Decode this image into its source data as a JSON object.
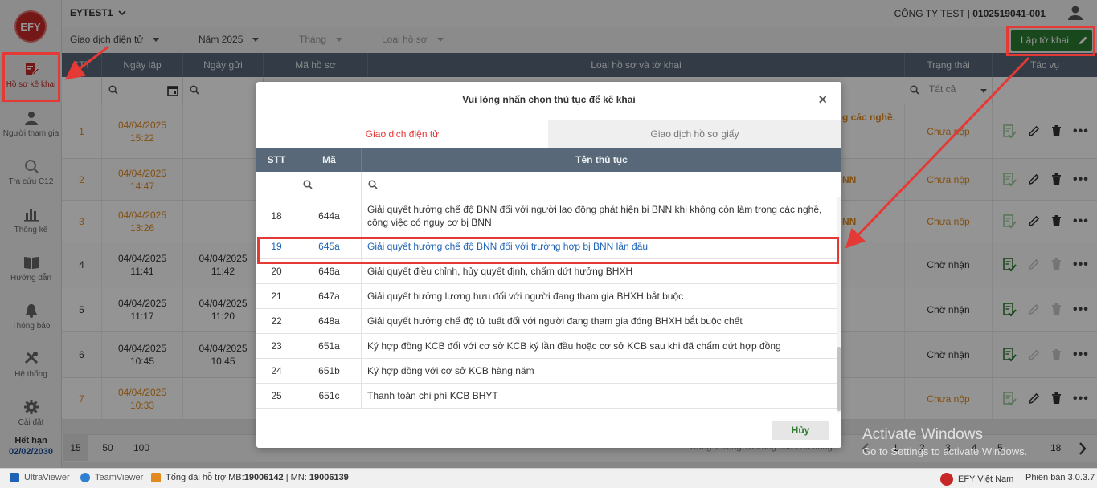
{
  "sidebar": {
    "logo": "EFY",
    "items": [
      {
        "label": "Hồ sơ kê khai",
        "icon": "document-edit-icon"
      },
      {
        "label": "Người tham gia",
        "icon": "person-icon"
      },
      {
        "label": "Tra cứu C12",
        "icon": "search-icon"
      },
      {
        "label": "Thống kê",
        "icon": "bar-chart-icon"
      },
      {
        "label": "Hướng dẫn",
        "icon": "book-icon"
      },
      {
        "label": "Thông báo",
        "icon": "bell-icon"
      },
      {
        "label": "Hệ thống",
        "icon": "tools-icon"
      },
      {
        "label": "Cài đặt",
        "icon": "gear-icon"
      }
    ],
    "expiry_label": "Hết hạn",
    "expiry_date": "02/02/2030"
  },
  "topbar": {
    "company_select": "EYTEST1",
    "company_name": "CÔNG TY TEST | ",
    "company_code": "0102519041-001"
  },
  "filters": {
    "type": "Giao dịch điện tử",
    "year": "Năm 2025",
    "month": "Tháng",
    "record_type": "Loại hồ sơ",
    "create_button": "Lập tờ khai"
  },
  "main_table": {
    "headers": {
      "stt": "STT",
      "created": "Ngày lập",
      "sent": "Ngày gửi",
      "code": "Mã hồ sơ",
      "type": "Loại hồ sơ và tờ khai",
      "status": "Trạng thái",
      "actions": "Tác vụ"
    },
    "status_filter": "Tất cả",
    "rows": [
      {
        "stt": "1",
        "created_date": "04/04/2025",
        "created_time": "15:22",
        "sent_date": "",
        "sent_time": "",
        "type_stub": "g các nghề,",
        "status": "Chưa nộp"
      },
      {
        "stt": "2",
        "created_date": "04/04/2025",
        "created_time": "14:47",
        "sent_date": "",
        "sent_time": "",
        "type_stub": "NN",
        "status": "Chưa nộp"
      },
      {
        "stt": "3",
        "created_date": "04/04/2025",
        "created_time": "13:26",
        "sent_date": "",
        "sent_time": "",
        "type_stub": "NN",
        "status": "Chưa nộp"
      },
      {
        "stt": "4",
        "created_date": "04/04/2025",
        "created_time": "11:41",
        "sent_date": "04/04/2025",
        "sent_time": "11:42",
        "type_stub": "",
        "status": "Chờ nhận"
      },
      {
        "stt": "5",
        "created_date": "04/04/2025",
        "created_time": "11:17",
        "sent_date": "04/04/2025",
        "sent_time": "11:20",
        "type_stub": "",
        "status": "Chờ nhận"
      },
      {
        "stt": "6",
        "created_date": "04/04/2025",
        "created_time": "10:45",
        "sent_date": "04/04/2025",
        "sent_time": "10:45",
        "type_stub": "",
        "status": "Chờ nhận"
      },
      {
        "stt": "7",
        "created_date": "04/04/2025",
        "created_time": "10:33",
        "sent_date": "",
        "sent_time": "",
        "type_stub": "",
        "status": "Chưa nộp"
      }
    ]
  },
  "pagination": {
    "page_sizes": [
      "15",
      "50",
      "100"
    ],
    "info": "Trang 1 trong 18 trang của 259 dòng",
    "pages": [
      "1",
      "2",
      "3",
      "4",
      "5",
      "18"
    ]
  },
  "modal": {
    "title": "Vui lòng nhấn chọn thủ tục để kê khai",
    "close": "×",
    "tab_electronic": "Giao dịch điện tử",
    "tab_paper": "Giao dịch hồ sơ giấy",
    "headers": {
      "stt": "STT",
      "code": "Mã",
      "name": "Tên thủ tục"
    },
    "rows": [
      {
        "stt": "18",
        "code": "644a",
        "name": "Giải quyết hưởng chế độ BNN đối với người lao động phát hiện bị BNN khi không còn làm trong các nghề, công việc có nguy cơ bị BNN"
      },
      {
        "stt": "19",
        "code": "645a",
        "name": "Giải quyết hưởng chế độ BNN đối với trường hợp bị BNN lần đầu"
      },
      {
        "stt": "20",
        "code": "646a",
        "name": "Giải quyết điều chỉnh, hủy quyết định, chấm dứt hưởng BHXH"
      },
      {
        "stt": "21",
        "code": "647a",
        "name": "Giải quyết hưởng lương hưu đối với người đang tham gia BHXH bắt buộc"
      },
      {
        "stt": "22",
        "code": "648a",
        "name": "Giải quyết hưởng chế độ tử tuất đối với người đang tham gia đóng BHXH bắt buộc chết"
      },
      {
        "stt": "23",
        "code": "651a",
        "name": "Ký hợp đồng KCB đối với cơ sở KCB ký lần đầu hoặc cơ sở KCB sau khi đã chấm dứt hợp đồng"
      },
      {
        "stt": "24",
        "code": "651b",
        "name": "Ký hợp đồng với cơ sở KCB hàng năm"
      },
      {
        "stt": "25",
        "code": "651c",
        "name": "Thanh toán chi phí KCB BHYT"
      }
    ],
    "cancel": "Hủy"
  },
  "statusbar": {
    "ultraviewer": "UltraViewer",
    "teamviewer": "TeamViewer",
    "hotline_prefix": "Tổng đài hỗ trợ MB: ",
    "hotline_mb": "19006142",
    "hotline_sep": " | MN: ",
    "hotline_mn": "19006139",
    "brand": "EFY Việt Nam",
    "version": "Phiên bản 3.0.3.7"
  },
  "watermark": {
    "line1": "Activate Windows",
    "line2": "Go to Settings to activate Windows."
  },
  "colors": {
    "accent_red": "#e53935",
    "header_slate": "#596879",
    "create_green": "#2e7d32",
    "pending_orange": "#e28a1e",
    "link_blue": "#1e63b6"
  }
}
